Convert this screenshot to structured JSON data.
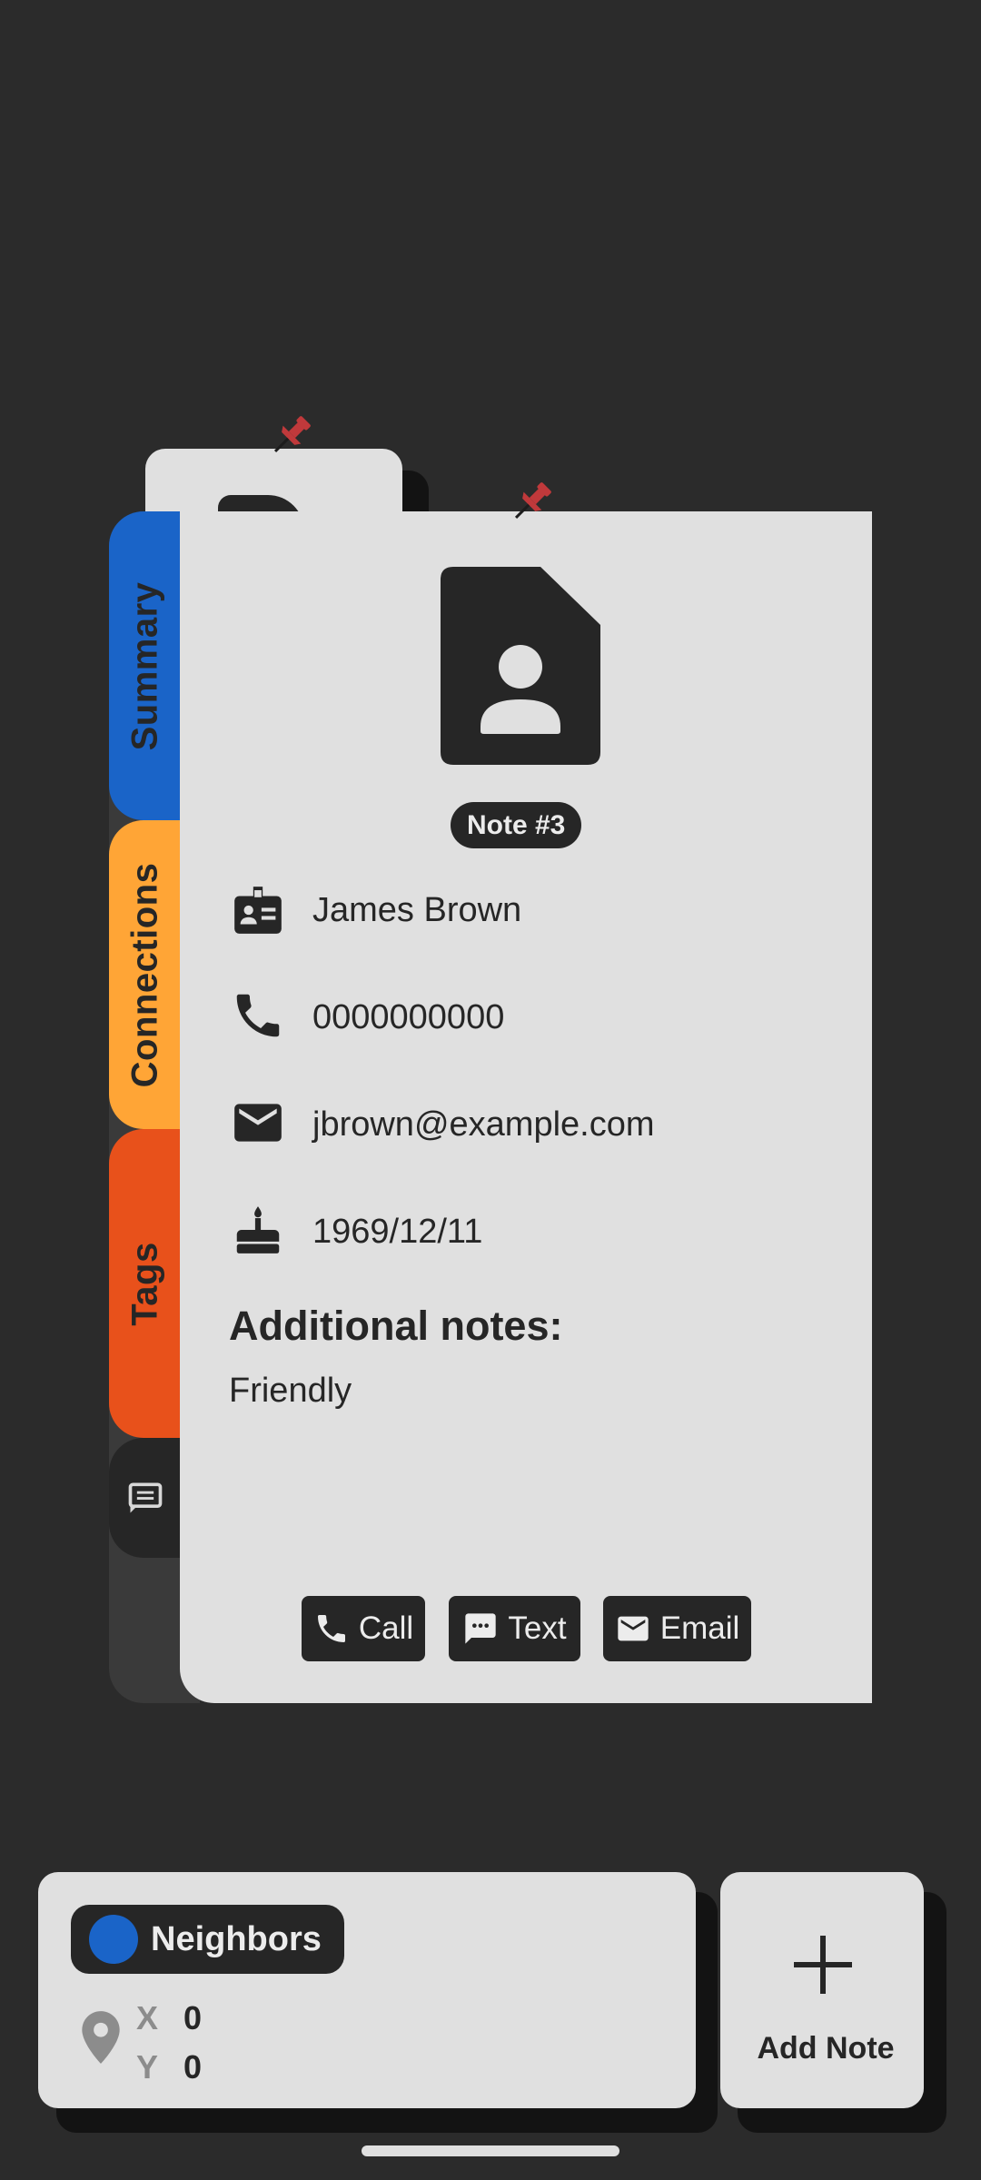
{
  "tabs": [
    {
      "label": "Summary",
      "color": "#1a64c8"
    },
    {
      "label": "Connections",
      "color": "#ffa536"
    },
    {
      "label": "Tags",
      "color": "#e8511b"
    },
    {
      "icon": "notes-icon"
    }
  ],
  "note": {
    "badge": "Note #3",
    "fields": [
      {
        "icon": "contact-card-icon",
        "value": "James Brown"
      },
      {
        "icon": "phone-icon",
        "value": "0000000000"
      },
      {
        "icon": "mail-icon",
        "value": "jbrown@example.com"
      },
      {
        "icon": "cake-icon",
        "value": "1969/12/11"
      }
    ],
    "additional_heading": "Additional notes:",
    "additional_text": "Friendly",
    "actions": [
      {
        "icon": "phone-icon",
        "label": "Call"
      },
      {
        "icon": "message-icon",
        "label": "Text"
      },
      {
        "icon": "mail-icon",
        "label": "Email"
      }
    ]
  },
  "group": {
    "label": "Neighbors",
    "color": "#1a64c8"
  },
  "location": {
    "x_label": "X",
    "x_value": "0",
    "y_label": "Y",
    "y_value": "0"
  },
  "add_note": {
    "label": "Add Note"
  },
  "colors": {
    "background": "#2b2b2b",
    "card": "#e0e0e0",
    "dark": "#262626",
    "pin": "#c0393b"
  }
}
